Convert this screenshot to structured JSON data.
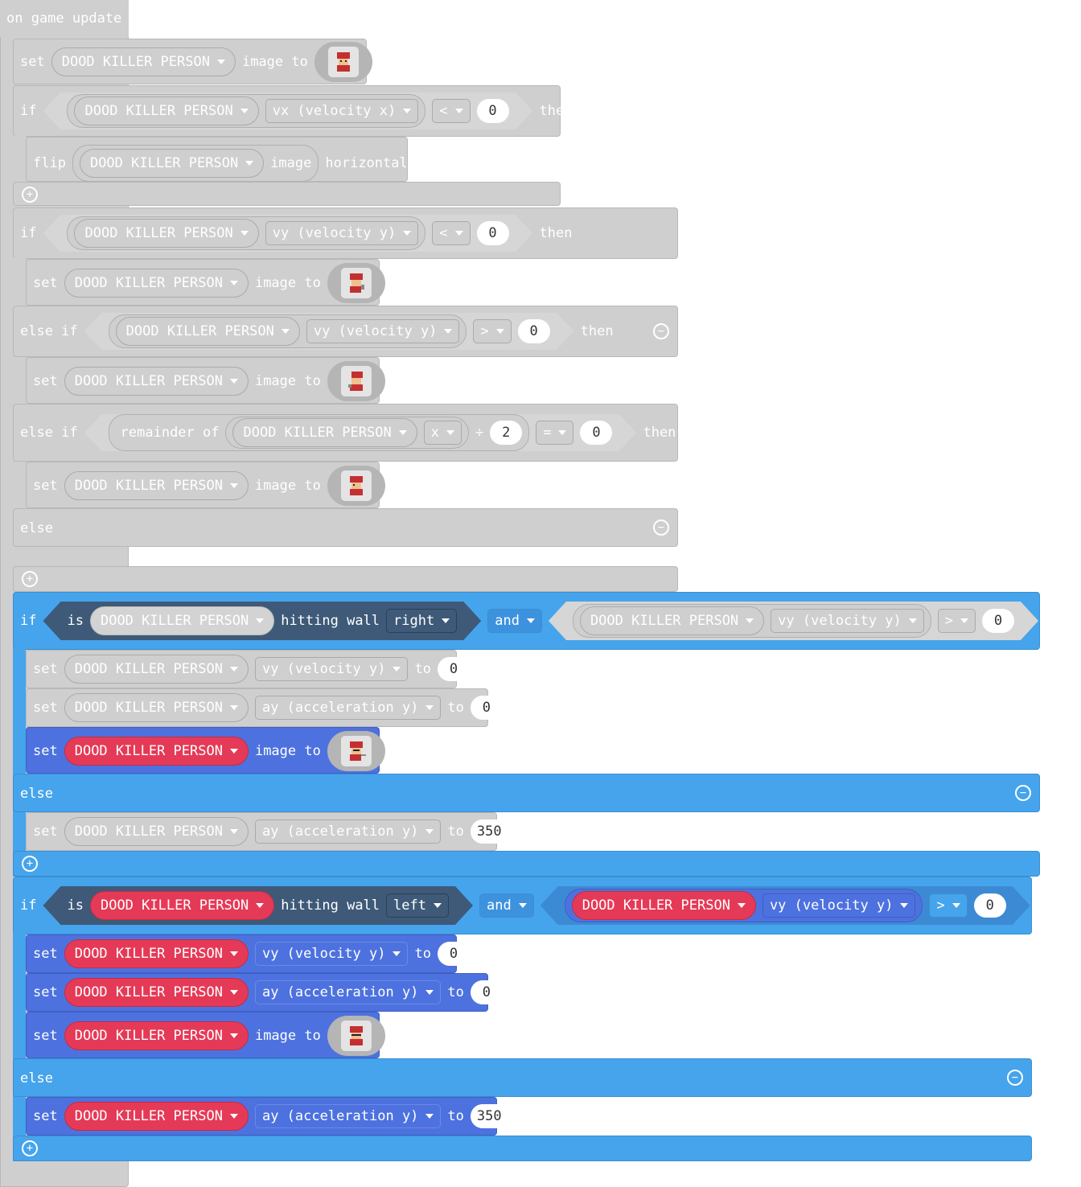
{
  "event": {
    "label": "on game update"
  },
  "sprite": "DOOD KILLER PERSON",
  "kw": {
    "set": "set",
    "if": "if",
    "then": "then",
    "else": "else",
    "else_if": "else if",
    "image_to": "image to",
    "to": "to",
    "flip": "flip",
    "image": "image",
    "horizontally": "horizontally",
    "is": "is",
    "hitting_wall": "hitting wall",
    "and": "and",
    "remainder_of": "remainder of",
    "divide": "÷"
  },
  "props": {
    "vx": "vx (velocity x)",
    "vy": "vy (velocity y)",
    "ay": "ay (acceleration y)",
    "x": "x"
  },
  "ops": {
    "lt": "<",
    "gt": ">",
    "eq": "="
  },
  "nums": {
    "zero": "0",
    "two": "2",
    "n350": "350"
  },
  "walls": {
    "right": "right",
    "left": "left"
  },
  "icons": {
    "plus": "plus-circle-icon",
    "minus": "minus-circle-icon",
    "dropdown": "chevron-down-icon",
    "sprite_image": "sprite-image-thumbnail"
  },
  "colors": {
    "gray_block": "#cfcfcf",
    "sky_block": "#45a4ec",
    "royal_block": "#4d72df",
    "sprite_red": "#e53a57",
    "wall_navy": "#3e5a78"
  }
}
